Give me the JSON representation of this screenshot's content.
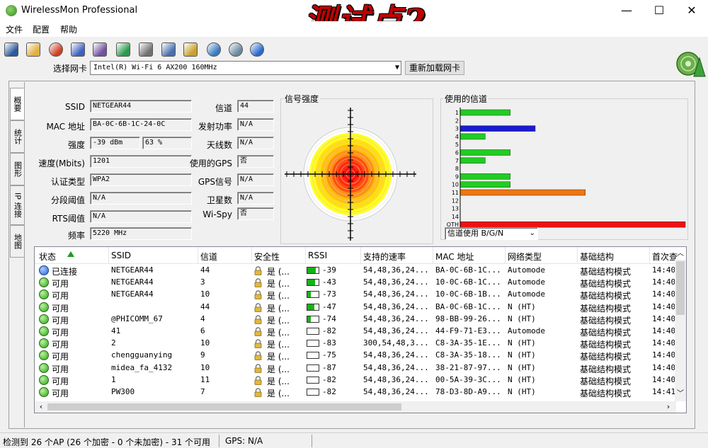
{
  "window": {
    "title": "WirelessMon Professional",
    "overlay_title": "测试点2",
    "minimize": "—",
    "maximize": "☐",
    "close": "✕"
  },
  "menu": [
    "文件",
    "配置",
    "帮助"
  ],
  "toolbar_icons": [
    "save-icon",
    "open-folder-icon",
    "record-icon",
    "network-icon",
    "network-alt-icon",
    "play-icon",
    "print-icon",
    "checklist-icon",
    "clipboard-icon",
    "globe-icon",
    "chat-icon",
    "help-icon"
  ],
  "adapter": {
    "label": "选择网卡",
    "value": "Intel(R) Wi-Fi 6 AX200 160MHz",
    "reload_label": "重新加载网卡"
  },
  "tabs": [
    "概要",
    "统计",
    "图形",
    "IP 连接",
    "地图"
  ],
  "info": {
    "ssid_label": "SSID",
    "ssid": "NETGEAR44",
    "mac_label": "MAC 地址",
    "mac": "BA-0C-6B-1C-24-0C",
    "strength_label": "强度",
    "strength_dbm": "-39 dBm",
    "strength_pct": "63 %",
    "speed_label": "速度(Mbits)",
    "speed": "1201",
    "auth_label": "认证类型",
    "auth": "WPA2",
    "frag_label": "分段阈值",
    "frag": "N/A",
    "rts_label": "RTS阈值",
    "rts": "N/A",
    "freq_label": "频率",
    "freq": "5220 MHz",
    "channel_label": "信道",
    "channel": "44",
    "txpower_label": "发射功率",
    "txpower": "N/A",
    "antenna_label": "天线数",
    "antenna": "N/A",
    "gps_used_label": "使用的GPS",
    "gps_used": "否",
    "gps_signal_label": "GPS信号",
    "gps_signal": "N/A",
    "satellites_label": "卫星数",
    "satellites": "N/A",
    "wispy_label": "Wi-Spy",
    "wispy": "否"
  },
  "signal_panel": {
    "title": "信号强度"
  },
  "channels_panel": {
    "title": "使用的信道",
    "filter_value": "信道使用 B/G/N",
    "labels": [
      "1",
      "2",
      "3",
      "4",
      "5",
      "6",
      "7",
      "8",
      "9",
      "10",
      "11",
      "12",
      "13",
      "14",
      "OTH"
    ],
    "usage": [
      4,
      0,
      6,
      2,
      0,
      4,
      2,
      0,
      4,
      4,
      10,
      0,
      0,
      0,
      18
    ],
    "usage_max": 18,
    "colors": [
      "#22cc22",
      "#22cc22",
      "#1a1ad0",
      "#22cc22",
      "#22cc22",
      "#22cc22",
      "#22cc22",
      "#22cc22",
      "#22cc22",
      "#22cc22",
      "#ee7711",
      "#22cc22",
      "#22cc22",
      "#22cc22",
      "#ee1111"
    ]
  },
  "list": {
    "columns": [
      "状态",
      "SSID",
      "信道",
      "安全性",
      "RSSI",
      "支持的速率",
      "MAC 地址",
      "网络类型",
      "基础结构",
      "首次查"
    ],
    "rows": [
      {
        "status": "已连接",
        "connected": true,
        "ssid": "NETGEAR44",
        "ch": "44",
        "sec": "是 (...",
        "rssi": "-39",
        "rssi_level": 0.75,
        "rates": "54,48,36,24...",
        "mac": "BA-0C-6B-1C...",
        "type": "Automode",
        "infra": "基础结构模式",
        "time": "14:40:"
      },
      {
        "status": "可用",
        "connected": false,
        "ssid": "NETGEAR44",
        "ch": "3",
        "sec": "是 (...",
        "rssi": "-43",
        "rssi_level": 0.7,
        "rates": "54,48,36,24...",
        "mac": "10-0C-6B-1C...",
        "type": "Automode",
        "infra": "基础结构模式",
        "time": "14:40:"
      },
      {
        "status": "可用",
        "connected": false,
        "ssid": "NETGEAR44",
        "ch": "10",
        "sec": "是 (...",
        "rssi": "-73",
        "rssi_level": 0.3,
        "rates": "54,48,36,24...",
        "mac": "10-0C-6B-1B...",
        "type": "Automode",
        "infra": "基础结构模式",
        "time": "14:40:"
      },
      {
        "status": "可用",
        "connected": false,
        "ssid": "",
        "ch": "44",
        "sec": "是 (...",
        "rssi": "-47",
        "rssi_level": 0.65,
        "rates": "54,48,36,24...",
        "mac": "BA-0C-6B-1C...",
        "type": "N (HT)",
        "infra": "基础结构模式",
        "time": "14:40:"
      },
      {
        "status": "可用",
        "connected": false,
        "ssid": "@PHICOMM_67",
        "ch": "4",
        "sec": "是 (...",
        "rssi": "-74",
        "rssi_level": 0.3,
        "rates": "54,48,36,24...",
        "mac": "98-BB-99-26...",
        "type": "N (HT)",
        "infra": "基础结构模式",
        "time": "14:40:"
      },
      {
        "status": "可用",
        "connected": false,
        "ssid": "41",
        "ch": "6",
        "sec": "是 (...",
        "rssi": "-82",
        "rssi_level": 0,
        "rates": "54,48,36,24...",
        "mac": "44-F9-71-E3...",
        "type": "Automode",
        "infra": "基础结构模式",
        "time": "14:40:"
      },
      {
        "status": "可用",
        "connected": false,
        "ssid": "2",
        "ch": "10",
        "sec": "是 (...",
        "rssi": "-83",
        "rssi_level": 0,
        "rates": "300,54,48,3...",
        "mac": "C8-3A-35-1E...",
        "type": "N (HT)",
        "infra": "基础结构模式",
        "time": "14:40:"
      },
      {
        "status": "可用",
        "connected": false,
        "ssid": "chengguanying",
        "ch": "9",
        "sec": "是 (...",
        "rssi": "-75",
        "rssi_level": 0,
        "rates": "54,48,36,24...",
        "mac": "C8-3A-35-18...",
        "type": "N (HT)",
        "infra": "基础结构模式",
        "time": "14:40:"
      },
      {
        "status": "可用",
        "connected": false,
        "ssid": "midea_fa_4132",
        "ch": "10",
        "sec": "是 (...",
        "rssi": "-87",
        "rssi_level": 0,
        "rates": "54,48,36,24...",
        "mac": "38-21-87-97...",
        "type": "N (HT)",
        "infra": "基础结构模式",
        "time": "14:40:"
      },
      {
        "status": "可用",
        "connected": false,
        "ssid": "1",
        "ch": "11",
        "sec": "是 (...",
        "rssi": "-82",
        "rssi_level": 0,
        "rates": "54,48,36,24...",
        "mac": "00-5A-39-3C...",
        "type": "N (HT)",
        "infra": "基础结构模式",
        "time": "14:40:"
      },
      {
        "status": "可用",
        "connected": false,
        "ssid": "PW300",
        "ch": "7",
        "sec": "是 (...",
        "rssi": "-82",
        "rssi_level": 0,
        "rates": "54,48,36,24...",
        "mac": "78-D3-8D-A9...",
        "type": "N (HT)",
        "infra": "基础结构模式",
        "time": "14:41:"
      }
    ]
  },
  "status_bar": {
    "summary": "检测到 26 个AP (26 个加密 - 0 个未加密) - 31 个可用",
    "gps": "GPS: N/A"
  }
}
